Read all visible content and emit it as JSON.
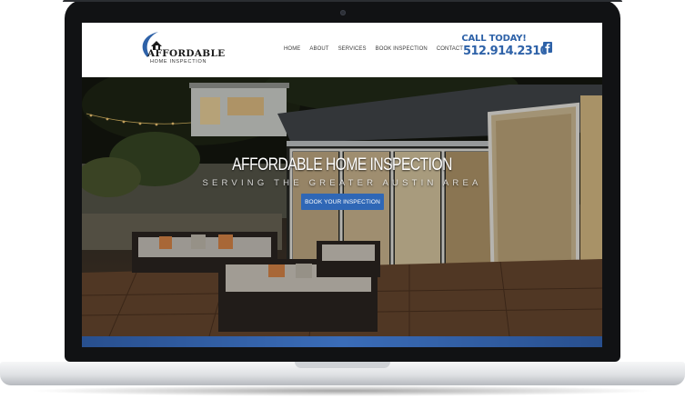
{
  "site": {
    "logo": {
      "title": "AFFORDABLE",
      "subtitle": "HOME INSPECTION"
    },
    "nav": [
      "HOME",
      "ABOUT",
      "SERVICES",
      "BOOK INSPECTION",
      "CONTACT"
    ],
    "call": {
      "label": "CALL TODAY!",
      "phone": "512.914.2310"
    },
    "social_icon": "facebook-icon"
  },
  "hero": {
    "title": "AFFORDABLE HOME INSPECTION",
    "subtitle": "SERVING THE GREATER AUSTIN AREA",
    "cta": "BOOK YOUR INSPECTION"
  },
  "colors": {
    "brand_blue": "#2e62a8",
    "button_blue": "#2f67b6",
    "frame": "#111214"
  }
}
